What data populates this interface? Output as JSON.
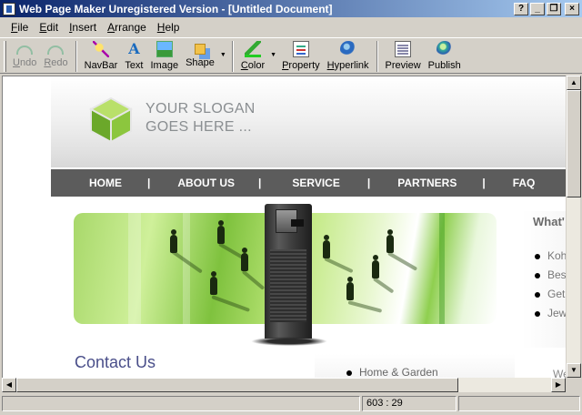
{
  "window": {
    "title": "Web Page Maker Unregistered Version - [Untitled Document]",
    "controls": {
      "help": "?",
      "minimize": "_",
      "restore": "❐",
      "close": "×"
    }
  },
  "menu": {
    "items": [
      {
        "key": "F",
        "rest": "ile"
      },
      {
        "key": "E",
        "rest": "dit"
      },
      {
        "key": "I",
        "rest": "nsert"
      },
      {
        "key": "A",
        "rest": "rrange"
      },
      {
        "key": "H",
        "rest": "elp"
      }
    ]
  },
  "toolbar": {
    "undo": {
      "label": "Undo",
      "key": "U",
      "rest": "ndo",
      "icon": "undo-icon",
      "enabled": false
    },
    "redo": {
      "label": "Redo",
      "key": "R",
      "rest": "edo",
      "icon": "redo-icon",
      "enabled": false
    },
    "navbar": {
      "label": "NavBar",
      "icon": "navbar-icon"
    },
    "text": {
      "label": "Text",
      "icon": "text-icon",
      "glyph": "A"
    },
    "image": {
      "label": "Image",
      "icon": "image-icon"
    },
    "shape": {
      "label": "Shape",
      "icon": "shape-icon"
    },
    "color": {
      "label": "Color",
      "key": "C",
      "rest": "olor",
      "icon": "color-icon"
    },
    "property": {
      "label": "Property",
      "key": "P",
      "rest": "roperty",
      "icon": "property-icon"
    },
    "hyperlink": {
      "label": "Hyperlink",
      "key": "H",
      "rest": "yperlink",
      "icon": "hyperlink-icon"
    },
    "preview": {
      "label": "Preview",
      "icon": "preview-icon"
    },
    "publish": {
      "label": "Publish",
      "icon": "publish-icon"
    },
    "dropdown_glyph": "▼"
  },
  "page": {
    "slogan_line1": "YOUR SLOGAN",
    "slogan_line2": "GOES HERE ...",
    "nav": [
      "HOME",
      "ABOUT US",
      "SERVICE",
      "PARTNERS",
      "FAQ"
    ],
    "nav_separator": "|",
    "side_heading": "What'",
    "side_items": [
      "Koh",
      "Best",
      "Get",
      "Jew"
    ],
    "contact_heading": "Contact Us",
    "bottom_item": "Home & Garden",
    "bottom_right": "We"
  },
  "scrollbars": {
    "up": "▲",
    "down": "▼",
    "left": "◀",
    "right": "▶"
  },
  "status": {
    "left": "",
    "coords": "603 : 29",
    "right": ""
  },
  "colors": {
    "titlebar_start": "#0a246a",
    "titlebar_end": "#a6caf0",
    "nav_bg": "#5c5c5c",
    "accent_green": "#7fc23e",
    "contact_text": "#4a4f8a"
  }
}
